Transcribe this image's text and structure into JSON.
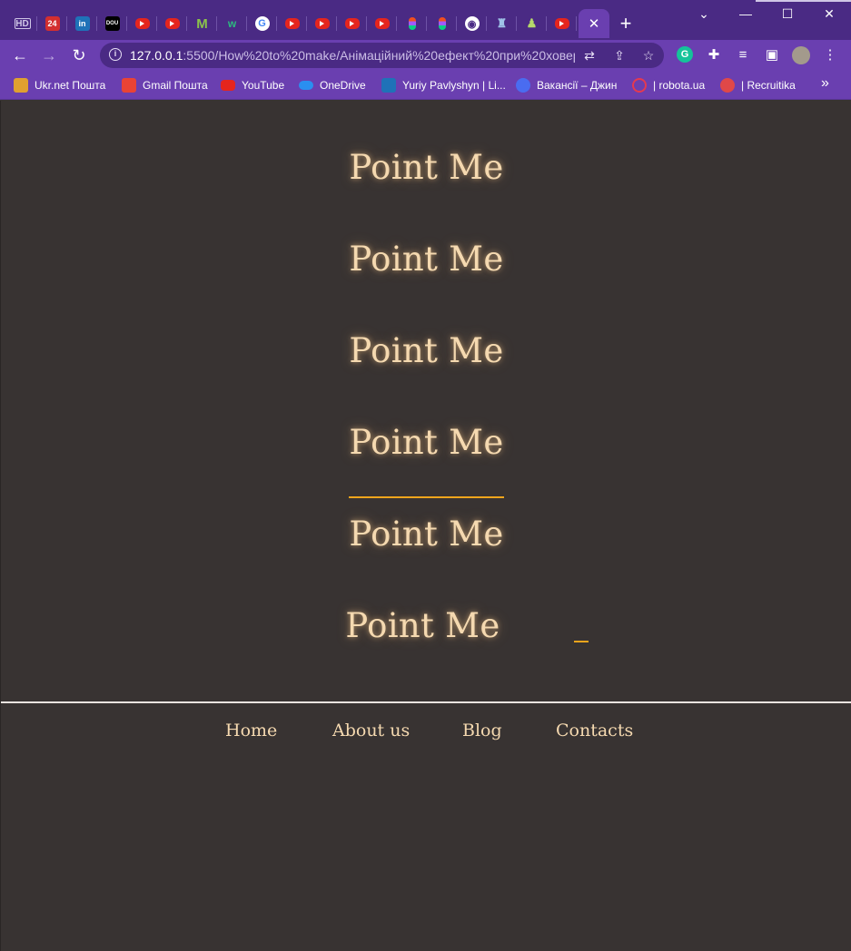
{
  "browser": {
    "tabs": [
      {
        "icon": "hd-icon",
        "glyph": "HD"
      },
      {
        "icon": "news24-icon",
        "glyph": "24"
      },
      {
        "icon": "linkedin-icon",
        "glyph": "in"
      },
      {
        "icon": "dou-icon",
        "glyph": "DOU"
      },
      {
        "icon": "youtube-icon",
        "glyph": ""
      },
      {
        "icon": "youtube-icon",
        "glyph": ""
      },
      {
        "icon": "m-logo-icon",
        "glyph": "M"
      },
      {
        "icon": "w-logo-icon",
        "glyph": "w"
      },
      {
        "icon": "google-icon",
        "glyph": "G"
      },
      {
        "icon": "youtube-icon",
        "glyph": ""
      },
      {
        "icon": "youtube-icon",
        "glyph": ""
      },
      {
        "icon": "youtube-icon",
        "glyph": ""
      },
      {
        "icon": "youtube-icon",
        "glyph": ""
      },
      {
        "icon": "figma-icon",
        "glyph": ""
      },
      {
        "icon": "figma-icon",
        "glyph": ""
      },
      {
        "icon": "globe-icon",
        "glyph": "◉"
      },
      {
        "icon": "cake-icon",
        "glyph": "♜"
      },
      {
        "icon": "person-icon",
        "glyph": "♟"
      },
      {
        "icon": "youtube-icon",
        "glyph": ""
      }
    ],
    "active_tab_close": "✕",
    "new_tab": "+",
    "window_controls": {
      "minimize": "—",
      "maximize": "☐",
      "close": "✕",
      "tab_search": "⌄"
    },
    "url_host": "127.0.0.1",
    "url_rest": ":5500/How%20to%20make/Анімаційний%20ефект%20при%20ховеру...",
    "toolbar": {
      "back": "←",
      "forward": "→",
      "reload": "↻",
      "info": "i"
    },
    "omnibox_icons": {
      "translate": "⇄",
      "share": "⇪",
      "bookmark": "☆"
    },
    "extensions": {
      "grammarly": "G",
      "puzzle": "✚",
      "media": "≡",
      "sidepanel": "▣",
      "menu": "⋮"
    },
    "bookmarks": [
      {
        "label": "Ukr.net Пошта",
        "color": "#e0a030"
      },
      {
        "label": "Gmail Пошта",
        "color": "#ea4335"
      },
      {
        "label": "YouTube",
        "color": "#e5251d"
      },
      {
        "label": "OneDrive",
        "color": "#2a8ff0"
      },
      {
        "label": "Yuriy Pavlyshyn | Li...",
        "color": "#1f72b8"
      },
      {
        "label": "Вакансії – Джин",
        "color": "#4a6cf0"
      },
      {
        "label": "| robota.ua",
        "color": "#e53950"
      },
      {
        "label": "| Recruitika",
        "color": "#e04848"
      }
    ],
    "bookmarks_more": "»"
  },
  "content": {
    "items": [
      {
        "label": "Point Me",
        "underline": "none"
      },
      {
        "label": "Point Me",
        "underline": "none"
      },
      {
        "label": "Point Me",
        "underline": "none"
      },
      {
        "label": "Point Me",
        "underline": "full"
      },
      {
        "label": "Point Me",
        "underline": "none"
      },
      {
        "label": "Point Me",
        "underline": "center"
      }
    ],
    "accent_color": "#f0a51c",
    "text_color": "#f5d9b0",
    "background": "#383332"
  },
  "nav": {
    "home": "Home",
    "about": "About us",
    "blog": "Blog",
    "contacts": "Contacts"
  }
}
